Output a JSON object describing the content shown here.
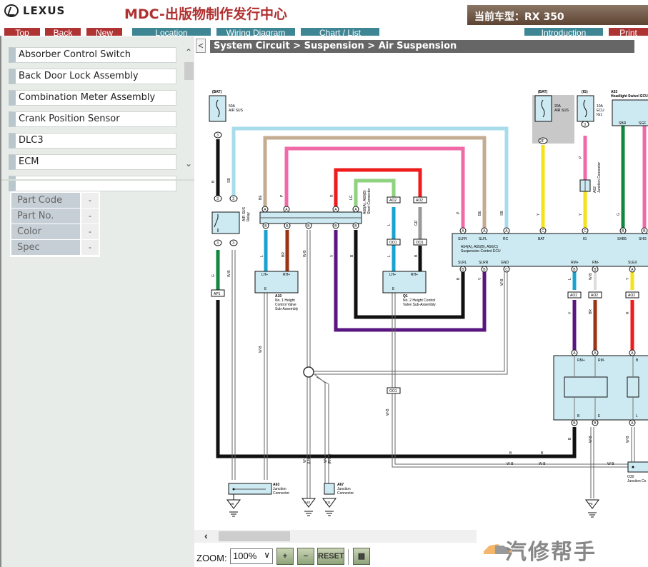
{
  "header": {
    "logo_text": "LEXUS",
    "site_title": "MDC-出版物制作发行中心",
    "current_model": "当前车型：RX 350"
  },
  "nav": {
    "top": "Top",
    "back": "Back",
    "new": "New",
    "location": "Location",
    "wiring_diagram": "Wiring Diagram",
    "chart_list": "Chart / List",
    "introduction": "Introduction",
    "print": "Print"
  },
  "sidebar": {
    "items": [
      {
        "label": "Absorber Control Switch"
      },
      {
        "label": "Back Door Lock Assembly"
      },
      {
        "label": "Combination Meter Assembly"
      },
      {
        "label": "Crank Position Sensor"
      },
      {
        "label": "DLC3"
      },
      {
        "label": "ECM"
      },
      {
        "label": ""
      }
    ],
    "parts": [
      {
        "label": "Part Code",
        "value": "-"
      },
      {
        "label": "Part No.",
        "value": "-"
      },
      {
        "label": "Color",
        "value": "-"
      },
      {
        "label": "Spec",
        "value": "-"
      }
    ]
  },
  "main": {
    "collapse": "<",
    "breadcrumb": "System Circuit > Suspension > Air Suspension"
  },
  "diagram": {
    "fuse1_src": "(BAT)",
    "fuse1_label1": "50A",
    "fuse1_label2": "AIR SUS",
    "fuse2_src": "(BAT)",
    "fuse2_label1": "20A",
    "fuse2_label2": "AIR SUS",
    "fuse3_src": "(IG)",
    "fuse3_label1": "10A",
    "fuse3_label2": "ECU",
    "fuse3_label3": "IG1",
    "relay_label1": "AIR SUS",
    "relay_label2": "Relay",
    "short_conn1": "A68(A), A69(B)",
    "short_conn2": "Short Connector",
    "a10_code": "A10",
    "a10_l1": "No. 1 Height",
    "a10_l2": "Control Valve",
    "a10_l3": "Sub-Assembly",
    "q1_code": "Q1",
    "q1_l1": "No. 2 Height Control",
    "q1_l2": "Valve Sub-Assembly",
    "ecu_l1": "A54(A), A55(B), A56(C)",
    "ecu_l2": "Suspension Control ECU",
    "ecu_pins_top": [
      "SLFR",
      "SLFL",
      "RC",
      "BAT",
      "IG",
      "SHB5",
      "SHG"
    ],
    "ecu_pins_bottom": [
      "SLRL",
      "SLRR",
      "GND",
      "RM+",
      "RM-",
      "SLEX"
    ],
    "a53_l1": "A53",
    "a53_l2": "Headlight Swivel ECU",
    "a53_pins": [
      "SBR",
      "SGF"
    ],
    "a62_code": "A62",
    "a62_name": "Junction Connector",
    "a63_code": "A63",
    "a63_l1": "Junction",
    "a63_l2": "Connector",
    "a67_code": "A67",
    "a67_l1": "Junction",
    "a67_l2": "Connector",
    "o30_code": "O30",
    "o30_name": "Junction Co",
    "comp_pins_top": [
      "RM+",
      "RM-",
      "B"
    ],
    "comp_pins_bottom": [
      "B",
      "E",
      "L"
    ],
    "grounds": [
      "A6",
      "A10",
      "A11",
      "P5"
    ],
    "connectors": [
      "AP1",
      "AO2",
      "AO2",
      "OO1",
      "OO1",
      "OO1",
      "AO2",
      "AO2",
      "AO2",
      "2F"
    ],
    "wire_colors": {
      "B": "#111111",
      "SB": "#a8dcea",
      "BE": "#c4ab92",
      "P": "#f06aa8",
      "R": "#ee1c1c",
      "LG": "#8fd27f",
      "L": "#1ba3cf",
      "BR": "#9a3415",
      "GR": "#9a9a9a",
      "V": "#5a1680",
      "Y": "#f6e21a",
      "G": "#12873d",
      "W-B": "#ffffff"
    },
    "wire_labels": {
      "b": "B",
      "sb": "SB",
      "be": "BE",
      "p": "P",
      "r": "R",
      "lg": "LG",
      "l": "L",
      "br": "BR",
      "gr": "GR",
      "v": "V",
      "y": "Y",
      "g": "G",
      "wb": "W-B",
      "lhd": "(LHD)",
      "rhd": "(RHD)"
    },
    "pin_labels": {
      "lh": "LH+",
      "rh": "RH+",
      "e": "E"
    }
  },
  "toolbar": {
    "zoom_label": "ZOOM:",
    "zoom_value": "100%",
    "zoom_in": "+",
    "zoom_out": "−",
    "reset": "RESET"
  },
  "watermark": {
    "text": "汽修帮手"
  }
}
